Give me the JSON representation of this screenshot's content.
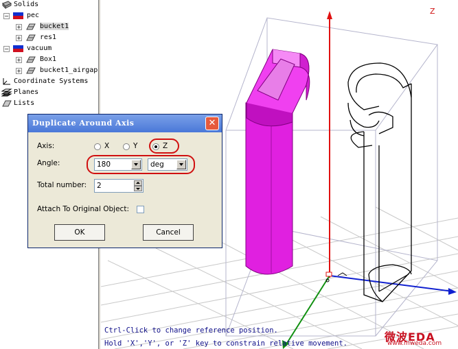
{
  "tree": {
    "items": [
      {
        "label": "Solids"
      },
      {
        "label": "pec"
      },
      {
        "label": "bucket1"
      },
      {
        "label": "res1"
      },
      {
        "label": "vacuum"
      },
      {
        "label": "Box1"
      },
      {
        "label": "bucket1_airgap"
      },
      {
        "label": "Coordinate Systems"
      },
      {
        "label": "Planes"
      },
      {
        "label": "Lists"
      }
    ]
  },
  "viewport": {
    "axis_label": "Z",
    "status_line_1": "Ctrl-Click to change reference position.",
    "status_line_2": "Hold 'X','Y', or 'Z' key to constrain relative movement.",
    "watermark_logo": "微波EDA",
    "watermark_url": "www.mweda.com",
    "colors": {
      "solid": "#e020e0",
      "z_axis": "#e01010",
      "x_axis": "#1020d0",
      "y_axis": "#109010"
    }
  },
  "dialog": {
    "title": "Duplicate Around Axis",
    "close_label": "✕",
    "axis_label": "Axis:",
    "axis_options": [
      "X",
      "Y",
      "Z"
    ],
    "axis_selected": "Z",
    "angle_label": "Angle:",
    "angle_value": "180",
    "angle_unit": "deg",
    "total_label": "Total number:",
    "total_value": "2",
    "attach_label": "Attach To Original Object:",
    "attach_checked": false,
    "ok_label": "OK",
    "cancel_label": "Cancel"
  }
}
